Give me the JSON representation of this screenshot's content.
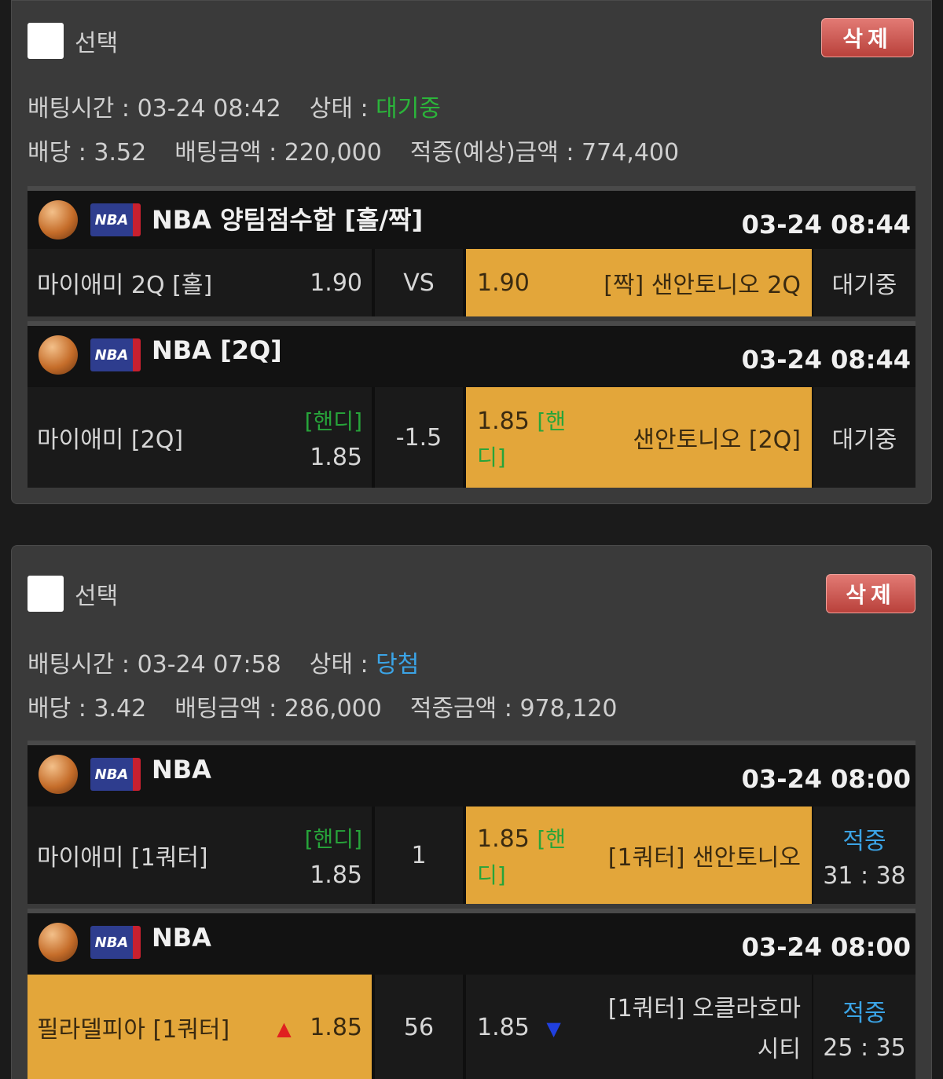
{
  "slips": [
    {
      "select_label": "선택",
      "delete_label": "삭제",
      "time_label": "배팅시간 : ",
      "time_value": "03-24 08:42",
      "status_label": "상태 : ",
      "status_value": "대기중",
      "odds_label": "배당 : ",
      "odds_value": "3.52",
      "amount_label": "배팅금액 : ",
      "amount_value": "220,000",
      "win_label": "적중(예상)금액 : ",
      "win_value": "774,400",
      "games": [
        {
          "league": "NBA 양팀점수합 [홀/짝]",
          "time": "03-24 08:44",
          "home": "마이애미 2Q [홀]",
          "home_odds": "1.90",
          "mid": "VS",
          "away_odds": "1.90",
          "away": "[짝] 샌안토니오 2Q",
          "result": "대기중"
        },
        {
          "league": "NBA [2Q]",
          "time": "03-24 08:44",
          "home": "마이애미 [2Q]",
          "home_tag": "[핸디]",
          "home_odds": "1.85",
          "mid": "-1.5",
          "away_odds": "1.85",
          "away_tag_a": "[핸",
          "away_tag_b": "디]",
          "away": "샌안토니오 [2Q]",
          "result": "대기중"
        }
      ]
    },
    {
      "select_label": "선택",
      "delete_label": "삭제",
      "time_label": "배팅시간 : ",
      "time_value": "03-24 07:58",
      "status_label": "상태 : ",
      "status_value": "당첨",
      "odds_label": "배당 : ",
      "odds_value": "3.42",
      "amount_label": "배팅금액 : ",
      "amount_value": "286,000",
      "win_label": "적중금액 : ",
      "win_value": "978,120",
      "games": [
        {
          "league": "NBA",
          "time": "03-24 08:00",
          "home": "마이애미 [1쿼터]",
          "home_tag": "[핸디]",
          "home_odds": "1.85",
          "mid": "1",
          "away_odds": "1.85",
          "away_tag_a": "[핸",
          "away_tag_b": "디]",
          "away": "[1쿼터] 샌안토니오",
          "result": "적중",
          "score": "31 : 38"
        },
        {
          "league": "NBA",
          "time": "03-24 08:00",
          "home": "필라델피아 [1쿼터]",
          "home_odds": "1.85",
          "up_arrow": "▲",
          "mid": "56",
          "away_odds": "1.85",
          "down_arrow": "▼",
          "away_a": "[1쿼터] 오클라호마",
          "away_b": "시티",
          "result": "적중",
          "score": "25 : 35"
        }
      ]
    }
  ],
  "nba_logo_text": "NBA",
  "colors": {
    "selected_cell": "#e3a63a",
    "status_wait": "#2bb53a",
    "status_win": "#3ba4e6",
    "delete_button": "#c9534c"
  }
}
